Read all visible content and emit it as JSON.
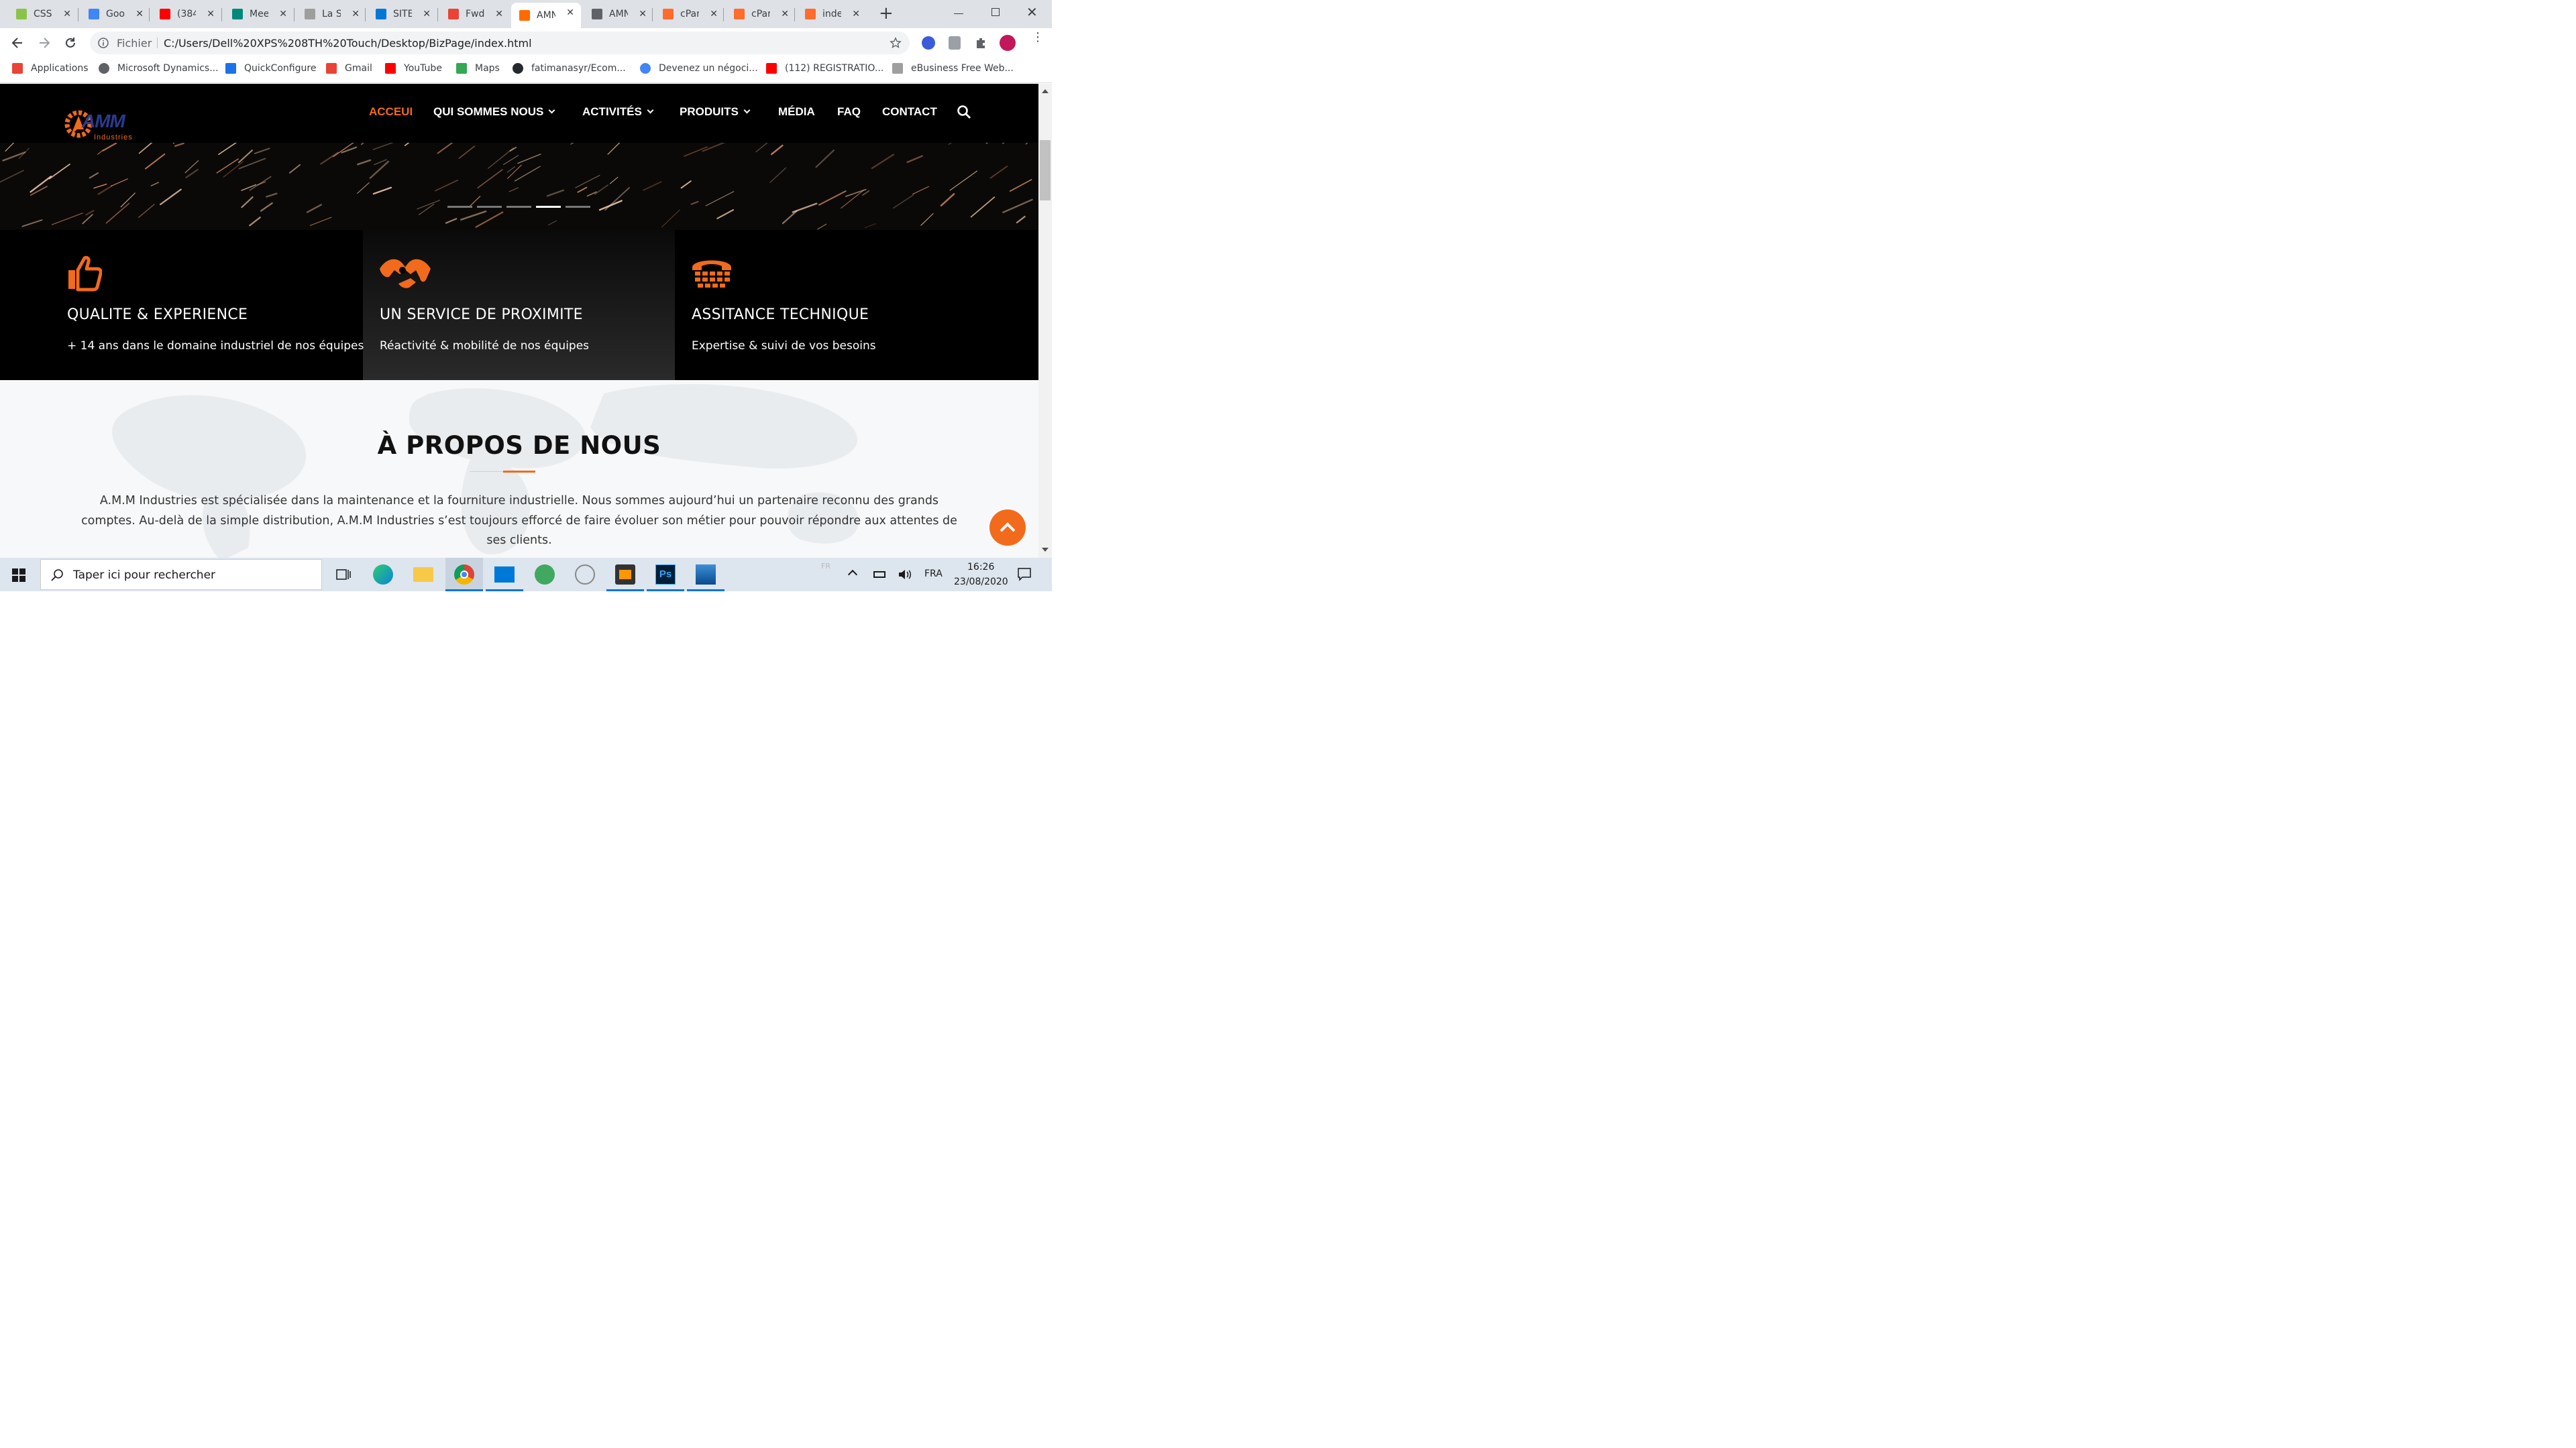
{
  "browser": {
    "tabs": [
      {
        "label": "CSS",
        "icon": "w3-favicon",
        "color": "#8bc34a"
      },
      {
        "label": "Goo",
        "icon": "google-translate-favicon",
        "color": "#4285f4"
      },
      {
        "label": "(384",
        "icon": "youtube-favicon",
        "color": "#ff0000"
      },
      {
        "label": "Mee",
        "icon": "meet-favicon",
        "color": "#00897b"
      },
      {
        "label": "La S",
        "icon": "b-favicon",
        "color": "#9e9e9e"
      },
      {
        "label": "SITE",
        "icon": "azure-devops-favicon",
        "color": "#0078d4"
      },
      {
        "label": "Fwd",
        "icon": "gmail-favicon",
        "color": "#ea4335"
      },
      {
        "label": "AMN",
        "icon": "amm-favicon",
        "color": "#ff6b00"
      },
      {
        "label": "AMN",
        "icon": "globe-favicon",
        "color": "#5f6368"
      },
      {
        "label": "cPar",
        "icon": "cpanel-favicon",
        "color": "#ff6c2c"
      },
      {
        "label": "cPar",
        "icon": "cpanel-favicon",
        "color": "#ff6c2c"
      },
      {
        "label": "inde",
        "icon": "cpanel-favicon",
        "color": "#ff6c2c"
      }
    ],
    "active_tab_index": 7,
    "new_tab_label": "+",
    "address_scheme": "Fichier",
    "address_url": "C:/Users/Dell%20XPS%208TH%20Touch/Desktop/BizPage/index.html",
    "bookmarks": [
      {
        "label": "Applications",
        "icon": "apps-grid-icon"
      },
      {
        "label": "Microsoft Dynamics...",
        "icon": "dynamics-icon"
      },
      {
        "label": "QuickConfigure",
        "icon": "quickconfigure-icon"
      },
      {
        "label": "Gmail",
        "icon": "gmail-icon"
      },
      {
        "label": "YouTube",
        "icon": "youtube-icon"
      },
      {
        "label": "Maps",
        "icon": "maps-pin-icon"
      },
      {
        "label": "fatimanasyr/Ecom...",
        "icon": "github-icon"
      },
      {
        "label": "Devenez un négoci...",
        "icon": "google-g-icon"
      },
      {
        "label": "(112) REGISTRATIO...",
        "icon": "youtube-icon"
      },
      {
        "label": "eBusiness Free Web...",
        "icon": "ebusiness-icon"
      }
    ]
  },
  "site": {
    "logo_mark": "AMM",
    "logo_sub": "Industries",
    "nav": [
      {
        "label": "ACCEUI",
        "active": true,
        "dropdown": false
      },
      {
        "label": "QUI SOMMES NOUS",
        "active": false,
        "dropdown": true
      },
      {
        "label": "ACTIVITÉS",
        "active": false,
        "dropdown": true
      },
      {
        "label": "PRODUITS",
        "active": false,
        "dropdown": true
      },
      {
        "label": "MÉDIA",
        "active": false,
        "dropdown": false
      },
      {
        "label": "FAQ",
        "active": false,
        "dropdown": false
      },
      {
        "label": "CONTACT",
        "active": false,
        "dropdown": false
      }
    ],
    "accent_color": "#f26a1b",
    "carousel": {
      "slide_count": 5,
      "active_index": 3
    },
    "features": [
      {
        "icon": "thumbs-up-icon",
        "title": "QUALITE & EXPERIENCE",
        "desc": "+ 14 ans dans le domaine industriel de nos équipes"
      },
      {
        "icon": "handshake-icon",
        "title": "UN SERVICE DE PROXIMITE",
        "desc": "Réactivité & mobilité de nos équipes"
      },
      {
        "icon": "telephone-icon",
        "title": "ASSITANCE TECHNIQUE",
        "desc": "Expertise & suivi de vos besoins"
      }
    ],
    "about": {
      "title": "À PROPOS DE NOUS",
      "lines": [
        "A.M.M Industries est spécialisée dans la maintenance et la fourniture industrielle. Nous sommes aujourd’hui un partenaire reconnu des grands",
        "comptes. Au-delà de la simple distribution, A.M.M Industries s’est toujours efforcé de faire évoluer son métier pour pouvoir répondre aux attentes de",
        "ses clients."
      ]
    }
  },
  "taskbar": {
    "search_placeholder": "Taper ici pour rechercher",
    "language": "FRA",
    "input_hint": "FR",
    "time": "16:26",
    "date": "23/08/2020"
  }
}
